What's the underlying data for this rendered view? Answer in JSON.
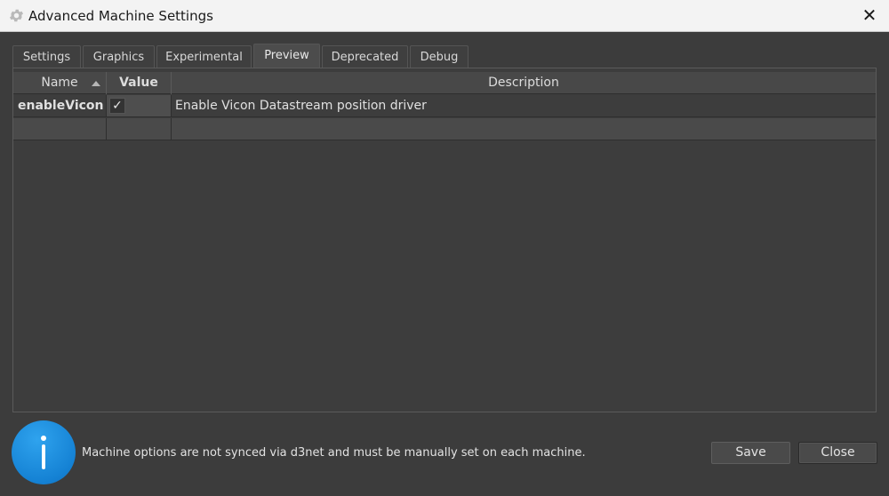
{
  "window": {
    "title": "Advanced Machine Settings",
    "icon": "gear-icon",
    "close_glyph": "✕"
  },
  "tabs": [
    {
      "label": "Settings",
      "active": false
    },
    {
      "label": "Graphics",
      "active": false
    },
    {
      "label": "Experimental",
      "active": false
    },
    {
      "label": "Preview",
      "active": true
    },
    {
      "label": "Deprecated",
      "active": false
    },
    {
      "label": "Debug",
      "active": false
    }
  ],
  "table": {
    "columns": {
      "name": "Name",
      "value": "Value",
      "description": "Description"
    },
    "sort": {
      "column": "name",
      "direction": "ascending"
    },
    "rows": [
      {
        "name": "enableVicon",
        "value_checked": true,
        "check_glyph": "✓",
        "description": "Enable Vicon Datastream position driver"
      },
      {
        "name": "",
        "value_checked": null,
        "description": ""
      }
    ]
  },
  "footer": {
    "info_icon": "info-icon",
    "message": "Machine options are not synced via d3net and must be manually set on each machine.",
    "save_label": "Save",
    "close_label": "Close"
  },
  "colors": {
    "info_blue": "#1a8ae0",
    "background": "#3c3c3c",
    "titlebar": "#f3f3f3"
  }
}
